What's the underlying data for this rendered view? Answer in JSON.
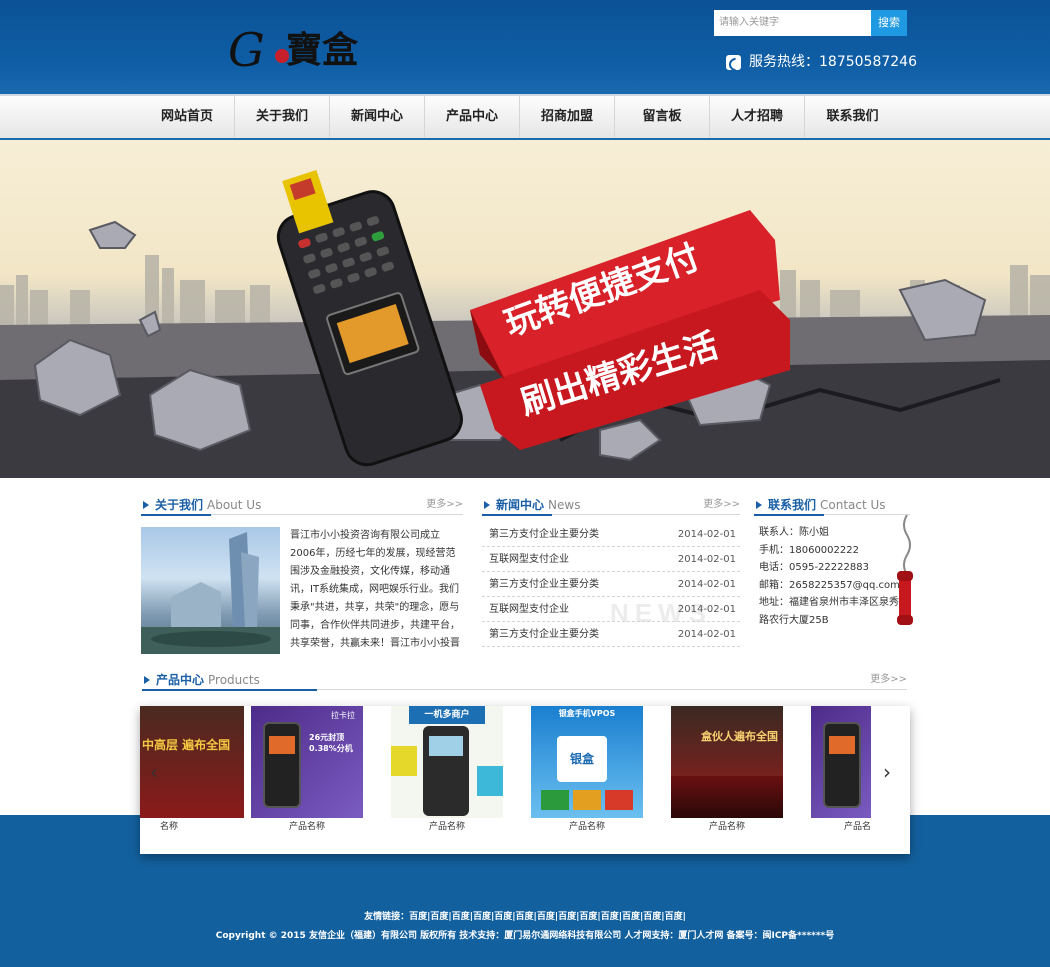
{
  "header": {
    "logo_text": "G寶盒",
    "search_placeholder": "请输入关键字",
    "search_button": "搜索",
    "hotline": "服务热线：18750587246"
  },
  "nav": {
    "items": [
      "网站首页",
      "关于我们",
      "新闻中心",
      "产品中心",
      "招商加盟",
      "留言板",
      "人才招聘",
      "联系我们"
    ]
  },
  "banner": {
    "line1": "玩转便捷支付",
    "line2": "刷出精彩生活"
  },
  "about": {
    "title": "关于我们",
    "title_en": "About Us",
    "more": "更多>>",
    "text": "晋江市小小投资咨询有限公司成立2006年，历经七年的发展，现经营范围涉及金融投资，文化传媒，移动通讯，IT系统集成，网吧娱乐行业。我们秉承\"共进，共享，共荣\"的理念，愿与同事，合作伙伴共同进步，共建平台，共享荣誉，共赢未来！晋江市小小投晋江市小小投晋江市"
  },
  "news": {
    "title": "新闻中心",
    "title_en": "News",
    "more": "更多>>",
    "watermark": "NEWS",
    "items": [
      {
        "title": "第三方支付企业主要分类",
        "date": "2014-02-01"
      },
      {
        "title": "互联网型支付企业",
        "date": "2014-02-01"
      },
      {
        "title": "第三方支付企业主要分类",
        "date": "2014-02-01"
      },
      {
        "title": "互联网型支付企业",
        "date": "2014-02-01"
      },
      {
        "title": "第三方支付企业主要分类",
        "date": "2014-02-01"
      }
    ]
  },
  "contact": {
    "title": "联系我们",
    "title_en": "Contact Us",
    "person": "联系人：陈小姐",
    "mobile": "手机：18060002222",
    "tel": "电话：0595-22222883",
    "email": "邮箱：2658225357@qq.com",
    "address": "地址：福建省泉州市丰泽区泉秀路农行大厦25B"
  },
  "products": {
    "title": "产品中心",
    "title_en": "Products",
    "more": "更多>>",
    "items": [
      "名称",
      "产品名称",
      "产品名称",
      "产品名称",
      "产品名称",
      "产品名"
    ],
    "pic_texts": {
      "p2_brand": "拉卡拉",
      "p2_rate": "26元封顶 0.38%分机",
      "p3_banner": "一机多商户",
      "p4_banner": "银盒手机VPOS",
      "p4_logo": "银盒",
      "p1_sign": "中高层 遍布全国",
      "p5_sign": "盒伙人遍布全国"
    }
  },
  "footer": {
    "links": "友情链接：百度|百度|百度|百度|百度|百度|百度|百度|百度|百度|百度|百度|百度|",
    "copyright": "Copyright © 2015 友信企业（福建）有限公司 版权所有 技术支持：厦门易尔通网络科技有限公司 人才网支持：厦门人才网 备案号：闽ICP备******号"
  }
}
